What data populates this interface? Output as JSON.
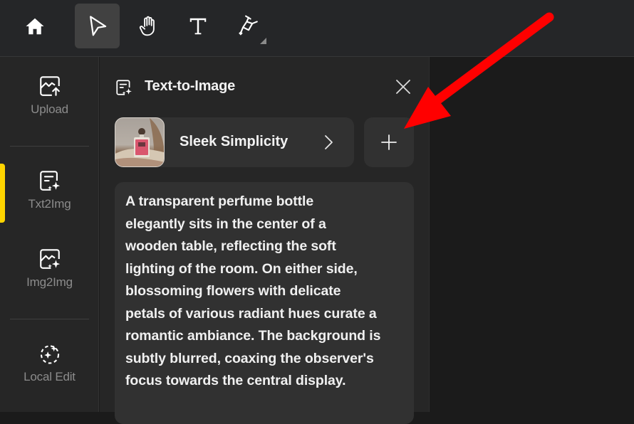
{
  "toolbar": {
    "tools": [
      {
        "name": "home",
        "icon": "home-icon",
        "active": false
      },
      {
        "name": "select",
        "icon": "pointer-arrow-icon",
        "active": true
      },
      {
        "name": "pan",
        "icon": "hand-icon",
        "active": false
      },
      {
        "name": "text",
        "icon": "text-t-icon",
        "active": false
      },
      {
        "name": "highlighter",
        "icon": "highlighter-icon",
        "active": false,
        "has_submenu": true
      }
    ]
  },
  "sidebar": {
    "items": [
      {
        "label": "Upload",
        "icon": "image-upload-icon",
        "active": false
      },
      {
        "label": "Txt2Img",
        "icon": "text-sparkle-icon",
        "active": true
      },
      {
        "label": "Img2Img",
        "icon": "image-sparkle-icon",
        "active": false
      },
      {
        "label": "Local Edit",
        "icon": "dashed-circle-sparkle-icon",
        "active": false
      }
    ],
    "active_indicator_color": "#ffd400"
  },
  "panel": {
    "title": "Text-to-Image",
    "style_card": {
      "name": "Sleek Simplicity",
      "thumbnail": "perfume-bottle-thumbnail"
    },
    "add_button_label": "+",
    "prompt": "A transparent perfume bottle\nelegantly sits in the center of a\nwooden table, reflecting the soft\nlighting of the room. On either side,\nblossoming flowers with delicate\npetals of various radiant hues curate a\nromantic ambiance. The background is\nsubtly blurred, coaxing the observer's\nfocus towards the central display."
  },
  "annotation": {
    "type": "arrow",
    "color": "#ff0000",
    "points_to": "add-style-button"
  }
}
